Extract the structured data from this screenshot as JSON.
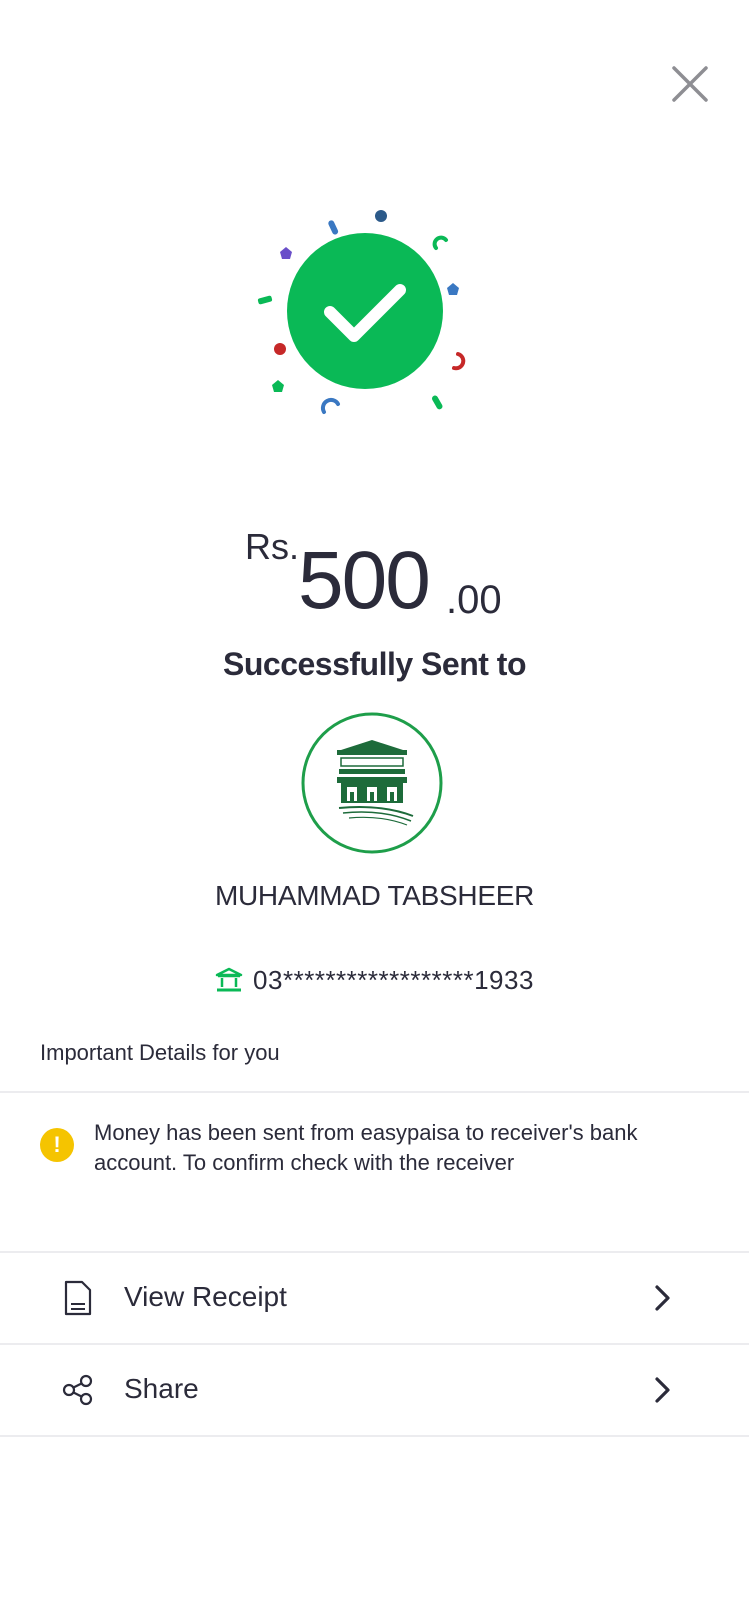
{
  "close": {
    "icon": "close-icon"
  },
  "success": {
    "icon": "checkmark-icon",
    "circle_color": "#0ab956"
  },
  "amount": {
    "currency": "Rs.",
    "whole": "500",
    "fraction": ".00"
  },
  "status_text": "Successfully Sent to",
  "recipient": {
    "bank_logo": "state-bank-of-pakistan-logo",
    "name": "MUHAMMAD TABSHEER",
    "account_masked": "03******************1933",
    "account_icon": "bank-icon"
  },
  "details": {
    "title": "Important Details for you",
    "notice_icon": "warning-icon",
    "notice_icon_glyph": "!",
    "notice_text": "Money has been sent from easypaisa to receiver's bank account. To confirm check with the receiver"
  },
  "actions": [
    {
      "label": "View Receipt",
      "icon": "receipt-icon"
    },
    {
      "label": "Share",
      "icon": "share-icon"
    }
  ],
  "colors": {
    "accent_green": "#0ab956",
    "text": "#2b2b3a",
    "warning": "#f5c400"
  }
}
